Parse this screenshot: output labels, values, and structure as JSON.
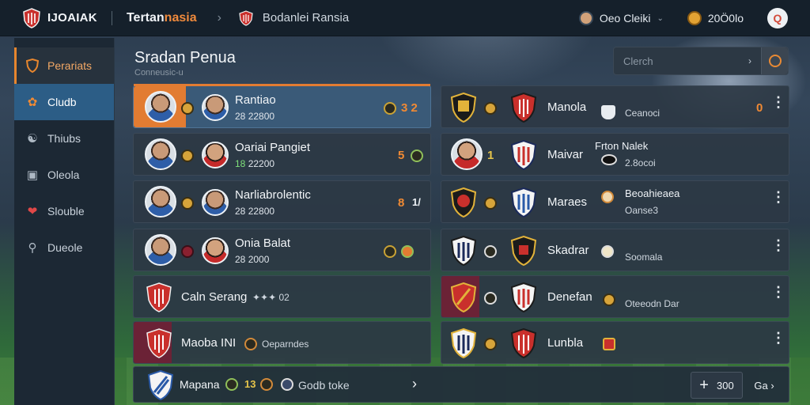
{
  "topbar": {
    "brand": "IJOAIAK",
    "title_a": "Tertan",
    "title_b": "nasia",
    "subtitle": "Bodanlei Ransia",
    "username": "Oeo Cleiki",
    "coins": "20Ö0lo",
    "search_glyph": "Q"
  },
  "sidebar": {
    "items": [
      {
        "label": "Perariats",
        "icon": "shield-icon"
      },
      {
        "label": "Cludb",
        "icon": "clubs-icon"
      },
      {
        "label": "Thiubs",
        "icon": "players-icon"
      },
      {
        "label": "Oleola",
        "icon": "square-icon"
      },
      {
        "label": "Slouble",
        "icon": "heart-icon"
      },
      {
        "label": "Dueole",
        "icon": "search-icon"
      }
    ]
  },
  "main": {
    "title": "Sradan Penua",
    "subtitle": "Conneusic-u",
    "filter_placeholder": "Clerch"
  },
  "left_cards": [
    {
      "name": "Rantiao",
      "stat_a": "28",
      "stat_b": "22800",
      "num": "2",
      "num_prefix": "3"
    },
    {
      "name": "Oariai Pangiet",
      "stat_a": "18",
      "stat_b": "22200",
      "num": "5"
    },
    {
      "name": "Narliabrolentic",
      "stat_a": "28",
      "stat_b": "22800",
      "num": "8",
      "num_suffix": "1/"
    },
    {
      "name": "Onia Balat",
      "stat_a": "28",
      "stat_b": "2000"
    },
    {
      "name": "Caln Serang",
      "extra": "02"
    },
    {
      "name": "Maoba INI",
      "extra": "Oeparndes"
    }
  ],
  "right_cards": [
    {
      "name": "Manola",
      "sub": "Ceanoci",
      "num": "0"
    },
    {
      "name": "Maivar",
      "title2": "Frton Nalek",
      "sub": "2.8ocoi",
      "num": "1"
    },
    {
      "name": "Maraes",
      "title2": "Beoahieaea",
      "sub": "Oanse3"
    },
    {
      "name": "Skadrar",
      "sub": "Soomala"
    },
    {
      "name": "Denefan",
      "sub": "Oteeodn Dar"
    },
    {
      "name": "Lunbla"
    }
  ],
  "bottom": {
    "team": "Mapana",
    "num": "13",
    "label": "Godb toke",
    "add_label": "300",
    "next_label": "Ga"
  }
}
